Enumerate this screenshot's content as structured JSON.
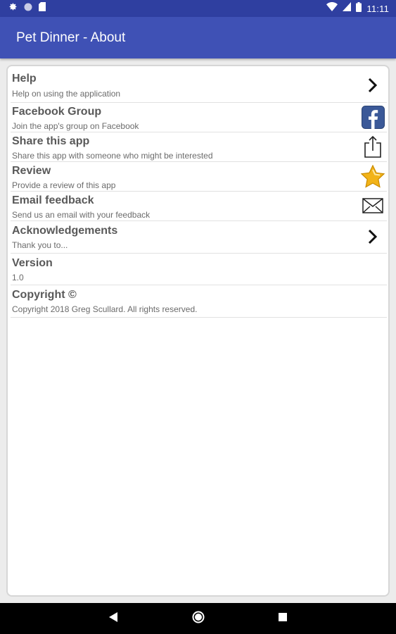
{
  "status_bar": {
    "time": "11:11"
  },
  "app_bar": {
    "title": "Pet Dinner - About"
  },
  "items": [
    {
      "title": "Help",
      "subtitle": "Help on using the application",
      "icon": "chevron-right-icon"
    },
    {
      "title": "Facebook Group",
      "subtitle": "Join the app's group on Facebook",
      "icon": "facebook-icon"
    },
    {
      "title": "Share this app",
      "subtitle": "Share this app with someone who might be interested",
      "icon": "share-icon"
    },
    {
      "title": "Review",
      "subtitle": "Provide a review of this app",
      "icon": "star-icon"
    },
    {
      "title": "Email feedback",
      "subtitle": "Send us an email with your feedback",
      "icon": "envelope-icon"
    },
    {
      "title": "Acknowledgements",
      "subtitle": "Thank you to...",
      "icon": "chevron-right-icon"
    },
    {
      "title": "Version",
      "subtitle": "1.0"
    },
    {
      "title": "Copyright ©",
      "subtitle": "Copyright 2018 Greg Scullard. All rights reserved."
    }
  ],
  "colors": {
    "status_bar": "#2f3fa0",
    "app_bar": "#3f51b5",
    "title_text": "#595959",
    "subtitle_text": "#6b6b6b",
    "facebook_blue": "#3b5998",
    "star_gold": "#f2b318"
  }
}
